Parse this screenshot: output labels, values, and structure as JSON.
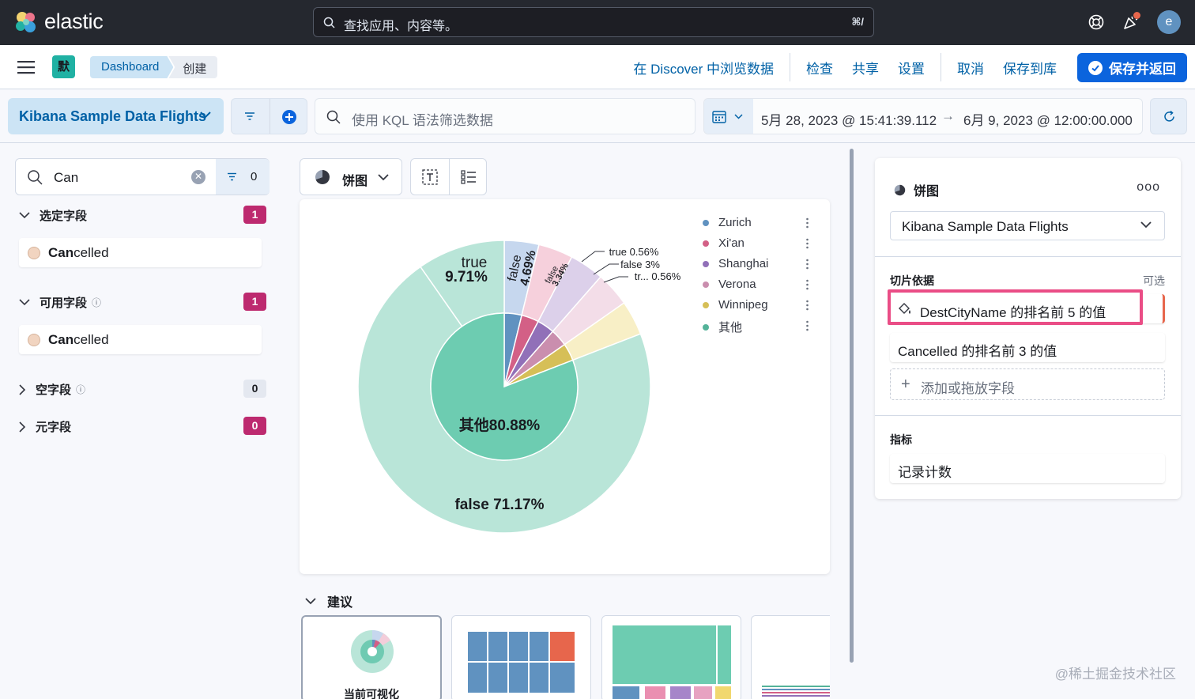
{
  "header": {
    "brand": "elastic",
    "search_placeholder": "查找应用、内容等。",
    "search_shortcut": "⌘/",
    "avatar_initial": "e"
  },
  "navbar": {
    "space_initial": "默",
    "breadcrumbs": [
      "Dashboard",
      "创建"
    ],
    "actions": [
      "在 Discover 中浏览数据",
      "检查",
      "共享",
      "设置",
      "取消",
      "保存到库"
    ],
    "save_return": "保存并返回"
  },
  "query": {
    "data_view": "Kibana Sample Data Flights",
    "kql_placeholder": "使用 KQL 语法筛选数据",
    "date_start": "5月 28, 2023 @ 15:41:39.112",
    "date_arrow": "→",
    "date_end": "6月 9, 2023 @ 12:00:00.000"
  },
  "sidebar": {
    "search_value": "Can",
    "filter_count": "0",
    "groups": [
      {
        "label": "选定字段",
        "count": "1",
        "field": "Cancelled",
        "match": "Can",
        "rest": "celled"
      },
      {
        "label": "可用字段",
        "count": "1",
        "field": "Cancelled",
        "match": "Can",
        "rest": "celled"
      },
      {
        "label": "空字段",
        "count": "0"
      },
      {
        "label": "元字段",
        "count": "0"
      }
    ]
  },
  "workspace": {
    "chart_type_label": "饼图",
    "suggestions_title": "建议",
    "current_viz_label": "当前可视化"
  },
  "chart_data": {
    "type": "pie",
    "title": "",
    "inner_ring": [
      {
        "label": "Zurich",
        "color": "#6092c0"
      },
      {
        "label": "Xi'an",
        "color": "#d36086"
      },
      {
        "label": "Shanghai",
        "color": "#9170b8"
      },
      {
        "label": "Verona",
        "color": "#ca8eae"
      },
      {
        "label": "Winnipeg",
        "color": "#d6bf57"
      },
      {
        "label": "其他",
        "value": 80.88,
        "color": "#54b399"
      }
    ],
    "outer_ring_labels": [
      {
        "text": "true",
        "value": "9.71%"
      },
      {
        "text": "false",
        "value": "4.69%"
      },
      {
        "text": "false",
        "value": "3.34%"
      },
      {
        "text": "true",
        "value": "0.56%"
      },
      {
        "text": "false",
        "value": "3%"
      },
      {
        "text": "tr...",
        "value": "0.56%"
      },
      {
        "text": "false",
        "value": "71.17%"
      }
    ],
    "center_label": "其他 80.88%",
    "legend": [
      "Zurich",
      "Xi'an",
      "Shanghai",
      "Verona",
      "Winnipeg",
      "其他"
    ],
    "legend_position": "top-right"
  },
  "config": {
    "chart_type_label": "饼图",
    "data_view": "Kibana Sample Data Flights",
    "slice_by_label": "切片依据",
    "optional_label": "可选",
    "slice_fields": [
      "DestCityName 的排名前 5 的值",
      "Cancelled 的排名前 3 的值"
    ],
    "add_field": "添加或拖放字段",
    "metric_label": "指标",
    "metric_value": "记录计数"
  },
  "watermark": "@稀土掘金技术社区",
  "colors": {
    "primary": "#0b64dd",
    "accent": "#bd2a6f",
    "highlight": "#ea4d86"
  }
}
